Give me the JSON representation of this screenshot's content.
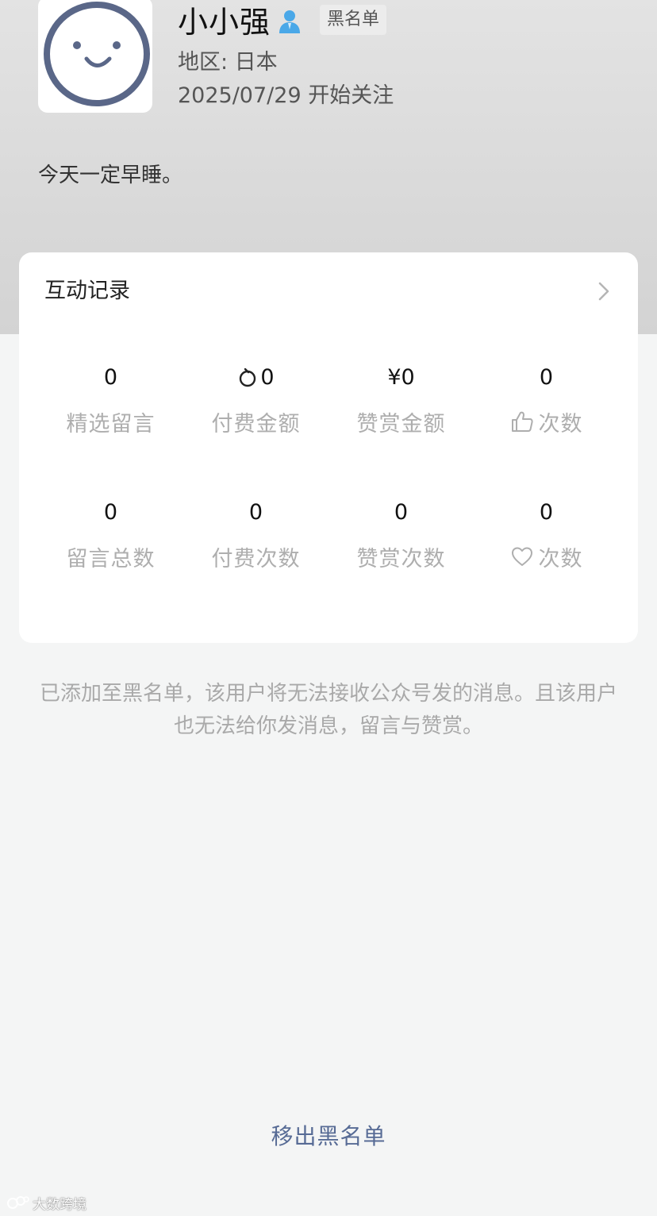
{
  "profile": {
    "nickname": "小小强",
    "tag": "黑名单",
    "region": "地区: 日本",
    "follow_date": "2025/07/29 开始关注",
    "signature": "今天一定早睡。",
    "avatar_icon": "smiley-face-avatar",
    "user_icon": "user-person-icon",
    "user_icon_color": "#4aa8e8"
  },
  "interaction": {
    "title": "互动记录",
    "chevron_icon": "chevron-right-icon",
    "stats": [
      {
        "value": "0",
        "label": "精选留言"
      },
      {
        "value": "0",
        "label": "付费金额",
        "value_icon": "coin-icon"
      },
      {
        "value": "¥0",
        "label": "赞赏金额"
      },
      {
        "value": "0",
        "label": "次数",
        "label_icon": "thumbs-up-icon"
      },
      {
        "value": "0",
        "label": "留言总数"
      },
      {
        "value": "0",
        "label": "付费次数"
      },
      {
        "value": "0",
        "label": "赞赏次数"
      },
      {
        "value": "0",
        "label": "次数",
        "label_icon": "heart-icon"
      }
    ]
  },
  "notice": {
    "line1": "已添加至黑名单，该用户将无法接收公众号发的消息。且该用户",
    "line2": "也无法给你发消息，留言与赞赏。"
  },
  "actions": {
    "remove_blacklist": "移出黑名单",
    "link_color": "#576b95"
  },
  "watermark": {
    "text": "大数跨境"
  }
}
